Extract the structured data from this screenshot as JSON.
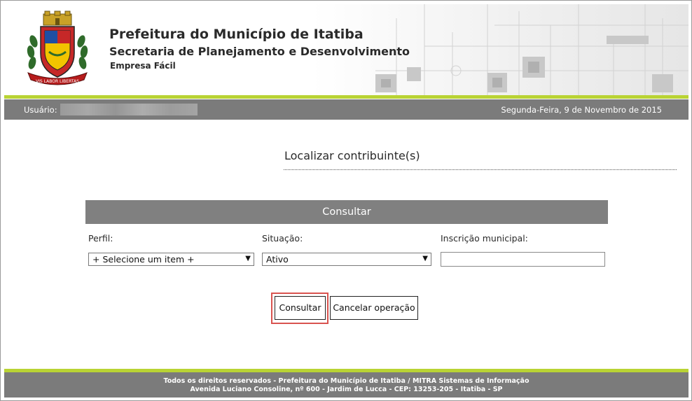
{
  "header": {
    "title": "Prefeitura do Município de Itatiba",
    "subtitle": "Secretaria de Planejamento e Desenvolvimento",
    "system": "Empresa Fácil",
    "crest_motto": "VIS LABOR LIBERTAS"
  },
  "userbar": {
    "user_label": "Usuário:",
    "date": "Segunda-Feira, 9 de Novembro de 2015"
  },
  "main": {
    "heading": "Localizar contribuinte(s)",
    "panel_title": "Consultar",
    "fields": {
      "perfil_label": "Perfil:",
      "perfil_value": "+ Selecione um item +",
      "situacao_label": "Situação:",
      "situacao_value": "Ativo",
      "inscricao_label": "Inscrição municipal:",
      "inscricao_value": ""
    },
    "buttons": {
      "consultar": "Consultar",
      "cancelar": "Cancelar operação"
    }
  },
  "footer": {
    "line1": "Todos os direitos reservados - Prefeitura do Município de Itatiba / MITRA Sistemas de Informação",
    "line2": "Avenida Luciano Consoline, nº 600 - Jardim de Lucca - CEP: 13253-205 - Itatiba - SP"
  },
  "colors": {
    "accent_green": "#b9d334",
    "bar_gray": "#7b7b7b",
    "panel_gray": "#808080",
    "highlight_red": "#d9534f"
  }
}
